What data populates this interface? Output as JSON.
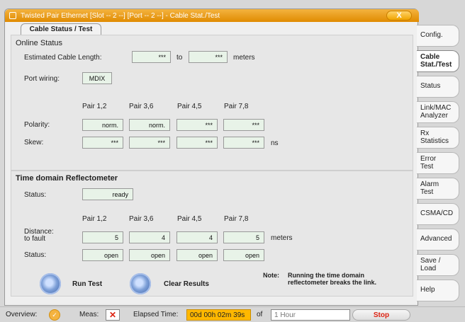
{
  "window": {
    "title": "Twisted Pair Ethernet [Slot -- 2 --] [Port -- 2 --] - Cable Stat./Test",
    "close_label": "X"
  },
  "tab": {
    "label": "Cable Status / Test"
  },
  "online": {
    "title": "Online Status",
    "estimated_label": "Estimated Cable Length:",
    "est_from": "***",
    "est_to_label": "to",
    "est_to": "***",
    "est_unit": "meters",
    "port_wiring_label": "Port wiring:",
    "port_wiring_value": "MDIX",
    "pair_headers": [
      "Pair 1,2",
      "Pair 3,6",
      "Pair 4,5",
      "Pair 7,8"
    ],
    "polarity_label": "Polarity:",
    "polarity_values": [
      "norm.",
      "norm.",
      "***",
      "***"
    ],
    "skew_label": "Skew:",
    "skew_values": [
      "***",
      "***",
      "***",
      "***"
    ],
    "skew_unit": "ns"
  },
  "tdr": {
    "title": "Time domain Reflectometer",
    "status_label": "Status:",
    "status_value": "ready",
    "pair_headers": [
      "Pair 1,2",
      "Pair 3,6",
      "Pair 4,5",
      "Pair 7,8"
    ],
    "distance_label": "Distance:\nto fault",
    "distance_values": [
      "5",
      "4",
      "4",
      "5"
    ],
    "distance_unit": "meters",
    "pair_status_label": "Status:",
    "pair_status_values": [
      "open",
      "open",
      "open",
      "open"
    ],
    "run_test_label": "Run Test",
    "clear_results_label": "Clear Results",
    "note_label": "Note:",
    "note_text": "Running the time domain reflectometer breaks the link."
  },
  "side_tabs": [
    {
      "label": "Config."
    },
    {
      "label": "Cable\nStat./Test",
      "active": true
    },
    {
      "label": "Status"
    },
    {
      "label": "Link/MAC\nAnalyzer"
    },
    {
      "label": "Rx\nStatistics"
    },
    {
      "label": "Error\nTest"
    },
    {
      "label": "Alarm\nTest"
    },
    {
      "label": "CSMA/CD"
    },
    {
      "label": "Advanced"
    },
    {
      "label": "Save /\nLoad"
    },
    {
      "label": "Help"
    }
  ],
  "bottom": {
    "overview_label": "Overview:",
    "meas_label": "Meas:",
    "elapsed_label": "Elapsed Time:",
    "elapsed_value": "00d 00h 02m 39s",
    "of_label": "of",
    "duration_value": "1 Hour",
    "stop_label": "Stop"
  },
  "colors": {
    "accent": "#e08b00",
    "value_field": "#e8f3e8",
    "elapsed": "#ffb800"
  }
}
